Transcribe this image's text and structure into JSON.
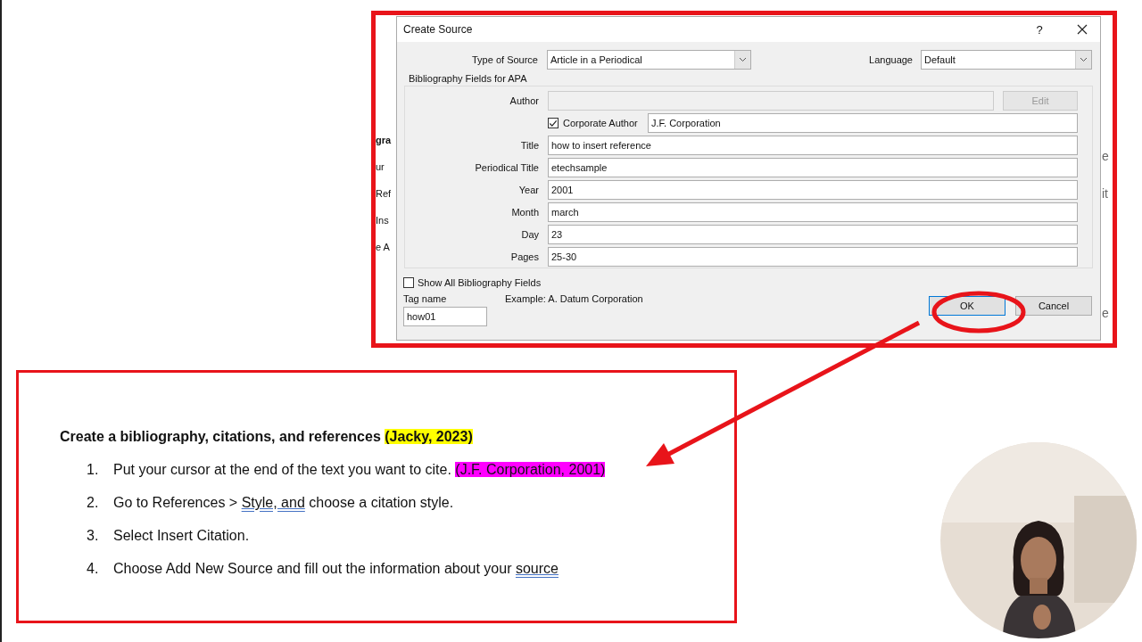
{
  "dialog": {
    "title": "Create Source",
    "help": "?",
    "type_of_source": {
      "label": "Type of Source",
      "value": "Article in a Periodical"
    },
    "language": {
      "label": "Language",
      "value": "Default"
    },
    "group_title": "Bibliography Fields for APA",
    "author": {
      "label": "Author",
      "disabled": true,
      "button": {
        "label": "Edit",
        "disabled": true
      }
    },
    "corporate_author": {
      "label": "Corporate Author",
      "checked": true,
      "value": "J.F. Corporation"
    },
    "fields": [
      {
        "label": "Title",
        "value": "how to insert reference"
      },
      {
        "label": "Periodical Title",
        "value": "etechsample"
      },
      {
        "label": "Year",
        "value": "2001"
      },
      {
        "label": "Month",
        "value": "march"
      },
      {
        "label": "Day",
        "value": "23"
      },
      {
        "label": "Pages",
        "value": "25-30"
      }
    ],
    "show_all": {
      "label": "Show All Bibliography Fields",
      "checked": false
    },
    "tag_name": {
      "label": "Tag name",
      "value": "how01"
    },
    "example": "Example: A. Datum Corporation",
    "buttons": [
      {
        "label": "OK",
        "default": true
      },
      {
        "label": "Cancel",
        "default": false
      }
    ]
  },
  "behind_left": [
    "gra",
    "ur",
    "Ref",
    "Ins",
    "e A"
  ],
  "behind_right": [
    "e",
    "it",
    "e"
  ],
  "document": {
    "heading": [
      {
        "kind": "plain",
        "text": "Create a bibliography, citations, and references "
      },
      {
        "kind": "highlight",
        "color": "#ffff00",
        "text": "(Jacky, 2023)"
      }
    ],
    "steps": [
      {
        "number": "1.",
        "segments": [
          {
            "kind": "plain",
            "text": "Put your cursor at the end of the text you want to cite. "
          },
          {
            "kind": "highlight",
            "color": "#ff00ff",
            "text": "(J.F. Corporation, 2001)"
          }
        ]
      },
      {
        "number": "2.",
        "segments": [
          {
            "kind": "plain",
            "text": "Go to References > "
          },
          {
            "kind": "flagged",
            "text": "Style, and"
          },
          {
            "kind": "plain",
            "text": " choose a citation style."
          }
        ]
      },
      {
        "number": "3.",
        "segments": [
          {
            "kind": "plain",
            "text": "Select Insert Citation."
          }
        ]
      },
      {
        "number": "4.",
        "segments": [
          {
            "kind": "plain",
            "text": "Choose Add New Source and fill out the information about your "
          },
          {
            "kind": "flagged",
            "text": "source"
          }
        ]
      }
    ]
  },
  "webcam": {
    "kind": "picture"
  }
}
